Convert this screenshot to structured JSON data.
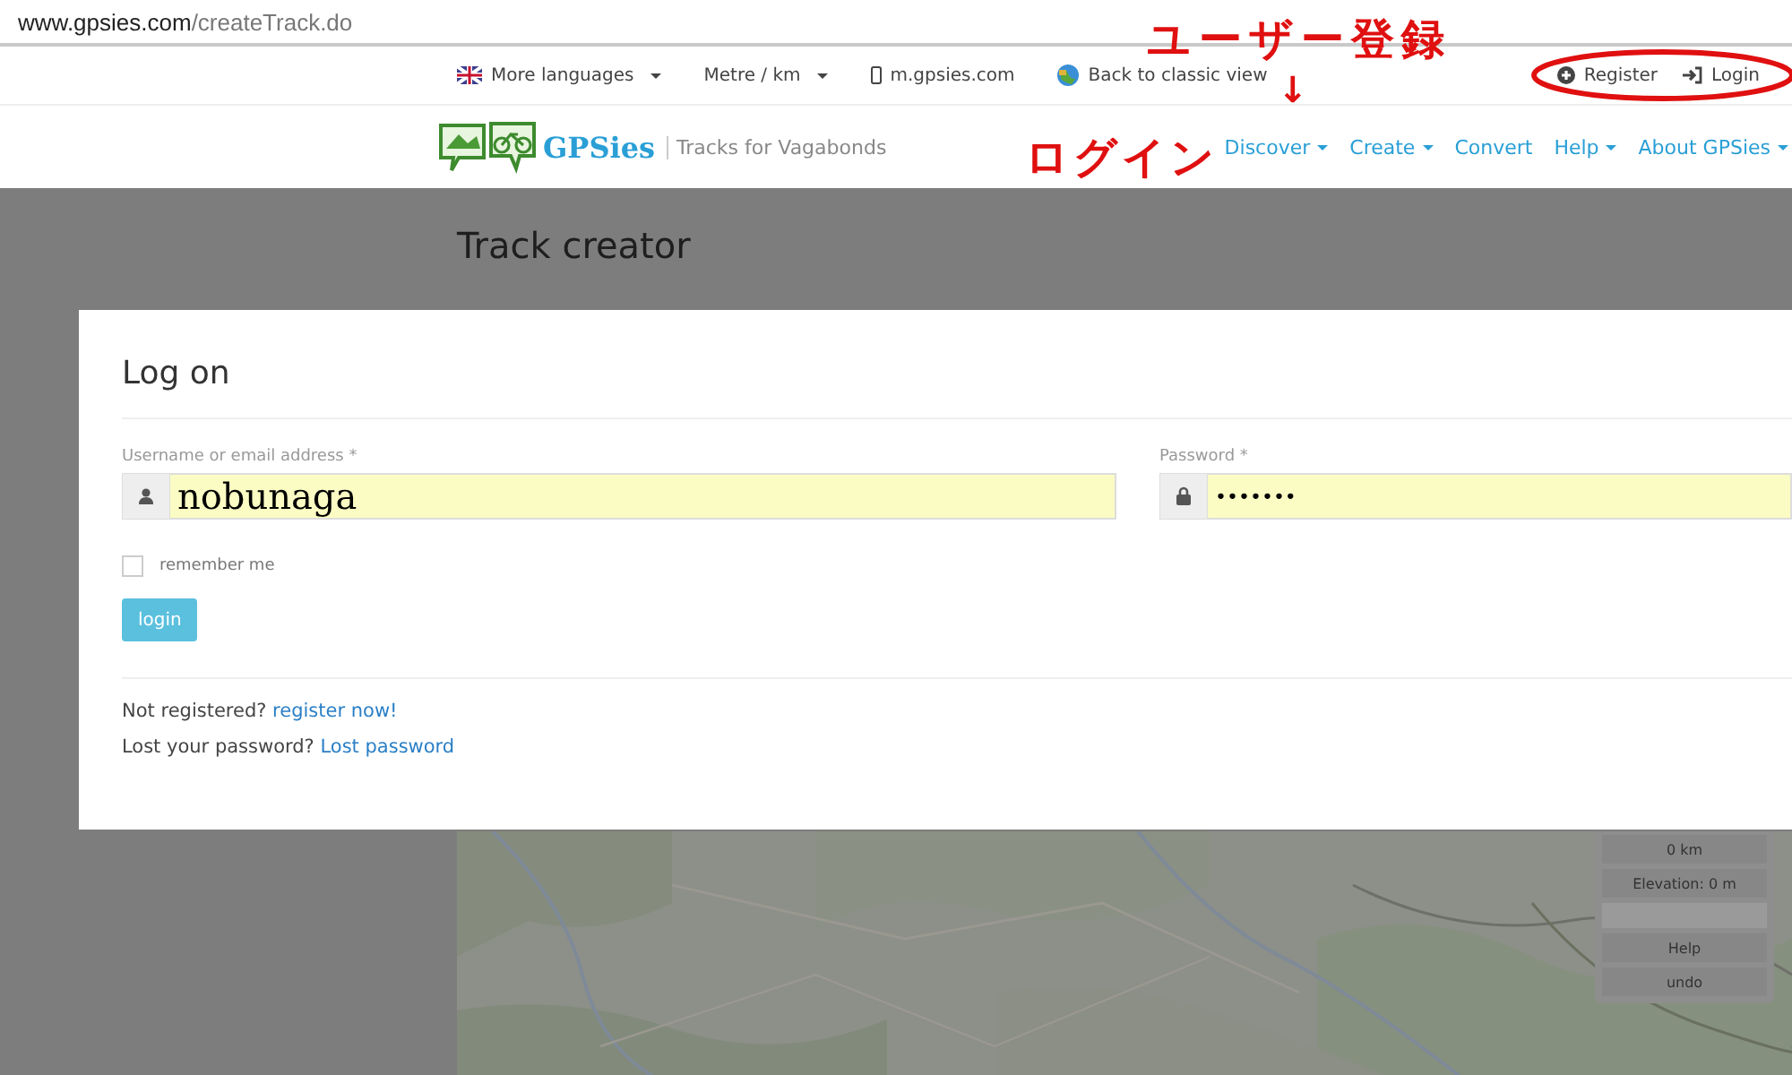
{
  "browser": {
    "url_host": "www.gpsies.com",
    "url_path": "/createTrack.do"
  },
  "top_bar": {
    "items": [
      {
        "kind": "flag",
        "label": "More languages",
        "dropdown": true
      },
      {
        "kind": "plain",
        "label": "Metre / km",
        "dropdown": true
      },
      {
        "kind": "phone",
        "label": "m.gpsies.com",
        "dropdown": false
      },
      {
        "kind": "globe",
        "label": "Back to classic view",
        "dropdown": false
      }
    ],
    "account": [
      {
        "kind": "register",
        "label": "Register"
      },
      {
        "kind": "login",
        "label": "Login"
      }
    ]
  },
  "header": {
    "logo": "GPSies",
    "tagline": "Tracks for Vagabonds",
    "menu": [
      {
        "label": "Discover",
        "dropdown": true
      },
      {
        "label": "Create",
        "dropdown": true
      },
      {
        "label": "Convert",
        "dropdown": false
      },
      {
        "label": "Help",
        "dropdown": true
      },
      {
        "label": "About GPSies",
        "dropdown": true
      }
    ]
  },
  "page_title": "Track creator",
  "dialog": {
    "title": "Log on",
    "username_label": "Username or email address *",
    "username_value": "nobunaga",
    "password_label": "Password *",
    "password_value": "•••••••",
    "remember": {
      "label": "remember me",
      "checked": false
    },
    "login_button": "login",
    "register_prompt": "Not registered?",
    "register_link": "register now!",
    "lost_prompt": "Lost your password?",
    "lost_link": "Lost password"
  },
  "map_panel": {
    "rows": [
      {
        "kind": "info",
        "label": "0 km"
      },
      {
        "kind": "info",
        "label": "Elevation: 0 m"
      },
      {
        "kind": "blank"
      },
      {
        "kind": "button",
        "label": "Help"
      },
      {
        "kind": "button",
        "label": "undo"
      }
    ]
  },
  "annotations": {
    "register_note": "ユーザー登録",
    "arrow": "↓",
    "login_note": "ログイン"
  }
}
